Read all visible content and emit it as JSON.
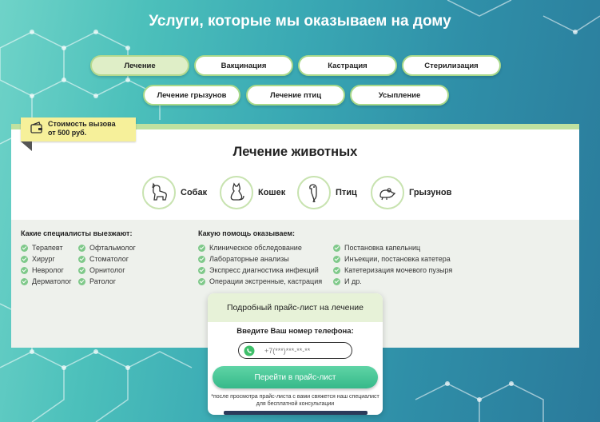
{
  "page": {
    "title": "Услуги, которые мы оказываем на дому"
  },
  "tabs": [
    {
      "label": "Лечение",
      "active": true
    },
    {
      "label": "Вакцинация",
      "active": false
    },
    {
      "label": "Кастрация",
      "active": false
    },
    {
      "label": "Стерилизация",
      "active": false
    },
    {
      "label": "Лечение грызунов",
      "active": false
    },
    {
      "label": "Лечение птиц",
      "active": false
    },
    {
      "label": "Усыпление",
      "active": false
    }
  ],
  "price_badge": {
    "line1": "Стоимость вызова",
    "line2": "от 500 руб.",
    "icon": "wallet-icon"
  },
  "section": {
    "title": "Лечение животных"
  },
  "animals": [
    {
      "label": "Собак",
      "icon": "dog-icon"
    },
    {
      "label": "Кошек",
      "icon": "cat-icon"
    },
    {
      "label": "Птиц",
      "icon": "bird-icon"
    },
    {
      "label": "Грызунов",
      "icon": "rodent-icon"
    }
  ],
  "specialists": {
    "title": "Какие специалисты выезжают:",
    "col1": [
      "Терапевт",
      "Хирург",
      "Невролог",
      "Дерматолог"
    ],
    "col2": [
      "Офтальмолог",
      "Стоматолог",
      "Орнитолог",
      "Ратолог"
    ]
  },
  "help": {
    "title": "Какую помощь оказываем:",
    "col1": [
      "Клиническое обследование",
      "Лабораторные анализы",
      "Экспресс диагностика инфекций",
      "Операции экстренные, кастрация"
    ],
    "col2": [
      "Постановка капельниц",
      "Инъекции, постановка катетера",
      "Катетеризация мочевого пузыря",
      "И др."
    ]
  },
  "form": {
    "header": "Подробный прайс-лист на лечение",
    "label": "Введите Ваш номер телефона:",
    "phone_placeholder": "+7(***)***-**-**",
    "button": "Перейти в прайс-лист",
    "note_line1": "*после просмотра прайс-листа с вами свяжется наш специалист",
    "note_line2": "для бесплатной консультации"
  },
  "colors": {
    "accent": "#36b98a",
    "tab_border": "#a9d98a",
    "badge": "#f6f09a"
  }
}
